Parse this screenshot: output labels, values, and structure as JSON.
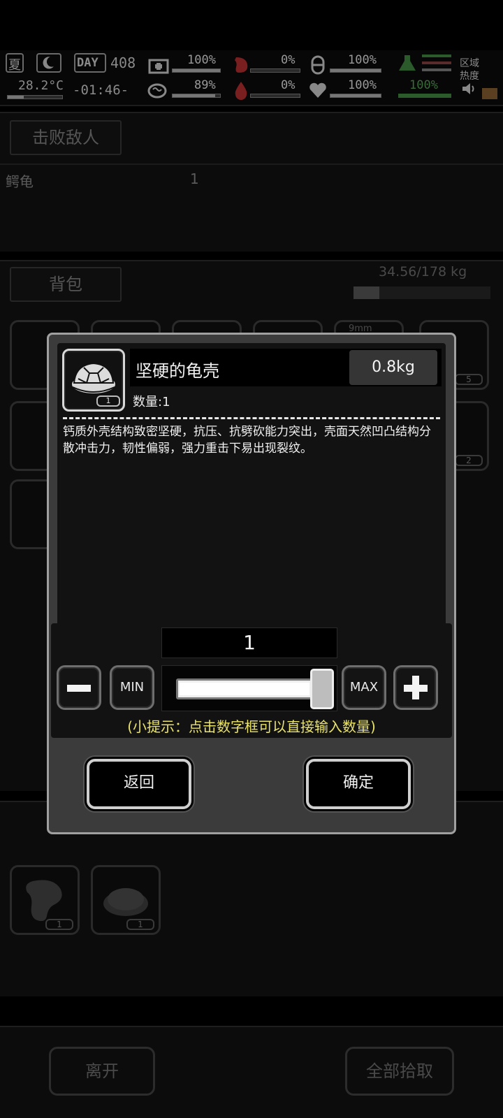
{
  "hud": {
    "season": "夏",
    "temperature": "28.2°C",
    "day_label": "DAY",
    "day_number": "408",
    "clock": "-01:46-",
    "zone_label_line1": "区域",
    "zone_label_line2": "热度",
    "stats": [
      {
        "icon": "medkit-icon",
        "value": "100%",
        "level": 1.0
      },
      {
        "icon": "stomach-icon",
        "value": "0%",
        "level": 0.0
      },
      {
        "icon": "pill-icon",
        "value": "100%",
        "level": 1.0
      },
      {
        "icon": "brain-icon",
        "value": "89%",
        "level": 0.89
      },
      {
        "icon": "blood-drop-icon",
        "value": "0%",
        "level": 0.0
      },
      {
        "icon": "heart-icon",
        "value": "100%",
        "level": 1.0
      },
      {
        "icon": "stamina-icon",
        "value": "100%",
        "level": 1.0
      }
    ]
  },
  "background": {
    "defeat_tab": "击败敌人",
    "enemy_name": "鳄龟",
    "enemy_count": "1",
    "backpack_tab": "背包",
    "backpack_weight": "34.56/178 kg",
    "backpack_fill": 0.19,
    "slot_counts": [
      "5",
      "2"
    ],
    "ammo_label": "9mm",
    "loot_counts": [
      "1",
      "1"
    ],
    "leave_button": "离开",
    "pickup_all_button": "全部拾取"
  },
  "dialog": {
    "item_name": "坚硬的龟壳",
    "item_weight": "0.8kg",
    "item_count_badge": "1",
    "quantity_line": "数量:1",
    "description": "钙质外壳结构致密坚硬，抗压、抗劈砍能力突出，壳面天然凹凸结构分散冲击力，韧性偏弱，强力重击下易出现裂纹。",
    "quantity_value": "1",
    "slider_level": 1.0,
    "min_label": "MIN",
    "max_label": "MAX",
    "hint": "(小提示：点击数字框可以直接输入数量)",
    "back_button": "返回",
    "confirm_button": "确定"
  },
  "colors": {
    "hint": "#e9e36a",
    "dialog_bg": "#3b3b3b",
    "panel_bg": "#121212"
  }
}
